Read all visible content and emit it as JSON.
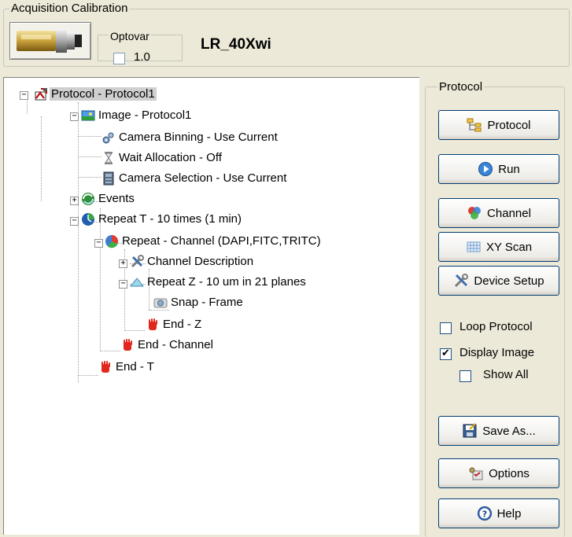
{
  "acquisition": {
    "group_title": "Acquisition Calibration",
    "optovar_label": "Optovar",
    "optovar_value": "1.0",
    "objective_name": "LR_40Xwi"
  },
  "tree": {
    "items": [
      {
        "label": "Protocol - Protocol1",
        "icon": "protocol-icon"
      },
      {
        "label": "Image - Protocol1",
        "icon": "image-icon"
      },
      {
        "label": "Camera Binning - Use Current",
        "icon": "gears-icon"
      },
      {
        "label": "Wait Allocation - Off",
        "icon": "hourglass-icon"
      },
      {
        "label": "Camera Selection - Use Current",
        "icon": "camera-selection-icon"
      },
      {
        "label": "Events",
        "icon": "events-icon"
      },
      {
        "label": "Repeat T - 10 times (1 min)",
        "icon": "clock-globe-icon"
      },
      {
        "label": "Repeat - Channel (DAPI,FITC,TRITC)",
        "icon": "channel-pie-icon"
      },
      {
        "label": "Channel Description",
        "icon": "tools-icon"
      },
      {
        "label": "Repeat Z - 10 um in 21 planes",
        "icon": "z-plane-icon"
      },
      {
        "label": "Snap - Frame",
        "icon": "camera-icon"
      },
      {
        "label": "End - Z",
        "icon": "hand-icon"
      },
      {
        "label": "End - Channel",
        "icon": "hand-icon"
      },
      {
        "label": "End - T",
        "icon": "hand-icon"
      }
    ]
  },
  "protocol_panel": {
    "group_title": "Protocol",
    "buttons": {
      "protocol": "Protocol",
      "run": "Run",
      "channel": "Channel",
      "xy_scan": "XY Scan",
      "device_setup": "Device Setup",
      "save_as": "Save As...",
      "options": "Options",
      "help": "Help"
    },
    "checkboxes": {
      "loop_protocol": {
        "label": "Loop Protocol",
        "checked": false
      },
      "display_image": {
        "label": "Display Image",
        "checked": true
      },
      "show_all": {
        "label": "Show All",
        "checked": false
      }
    }
  }
}
